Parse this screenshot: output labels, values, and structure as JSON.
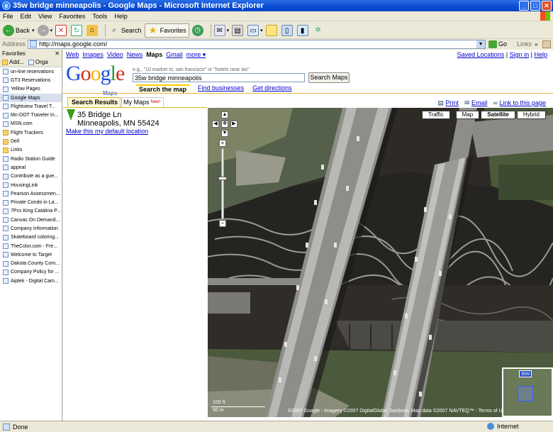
{
  "window": {
    "title": "35w bridge minneapolis - Google Maps - Microsoft Internet Explorer"
  },
  "menu": [
    "File",
    "Edit",
    "View",
    "Favorites",
    "Tools",
    "Help"
  ],
  "toolbar": {
    "back": "Back",
    "search": "Search",
    "favorites": "Favorites"
  },
  "address": {
    "label": "Address",
    "url": "http://maps.google.com/",
    "go": "Go",
    "links": "Links"
  },
  "favorites": {
    "title": "Favorites",
    "add": "Add...",
    "organize": "Orga",
    "items": [
      {
        "label": "on-line reservations",
        "icon": "page-icon"
      },
      {
        "label": "GT3 Reservations",
        "icon": "page-icon"
      },
      {
        "label": "Yellow Pages",
        "icon": "page-icon"
      },
      {
        "label": "Google Maps",
        "icon": "page-icon"
      },
      {
        "label": "Flightview  Travel T...",
        "icon": "page-icon"
      },
      {
        "label": "Mn-DOT Traveler In...",
        "icon": "page-icon"
      },
      {
        "label": "MSN.com",
        "icon": "page-icon"
      },
      {
        "label": "Flight Trackers",
        "icon": "folder-icon"
      },
      {
        "label": "Dell",
        "icon": "folder-icon"
      },
      {
        "label": "Links",
        "icon": "folder-icon"
      },
      {
        "label": "Radio Station Guide",
        "icon": "page-icon"
      },
      {
        "label": "appeal",
        "icon": "page-icon"
      },
      {
        "label": "Contribute as a gue...",
        "icon": "page-icon"
      },
      {
        "label": "HousingLink",
        "icon": "page-icon"
      },
      {
        "label": "Pearson Assessmen...",
        "icon": "page-icon"
      },
      {
        "label": "Private Condo in La...",
        "icon": "page-icon"
      },
      {
        "label": "7Pcs King Catalina P...",
        "icon": "page-icon"
      },
      {
        "label": "Canvas On Demand...",
        "icon": "page-icon"
      },
      {
        "label": "Company Information",
        "icon": "page-icon"
      },
      {
        "label": "Skateboard coloring...",
        "icon": "page-icon"
      },
      {
        "label": "TheColor.com - Fre...",
        "icon": "page-icon"
      },
      {
        "label": "Welcome to Target",
        "icon": "page-icon"
      },
      {
        "label": "Dakota County Com...",
        "icon": "page-icon"
      },
      {
        "label": "Company Policy for ...",
        "icon": "page-icon"
      },
      {
        "label": "Aiptek - Digital Cam...",
        "icon": "page-icon"
      }
    ]
  },
  "gnav": {
    "links": [
      {
        "label": "Web",
        "current": false
      },
      {
        "label": "Images",
        "current": false
      },
      {
        "label": "Video",
        "current": false
      },
      {
        "label": "News",
        "current": false
      },
      {
        "label": "Maps",
        "current": true
      },
      {
        "label": "Gmail",
        "current": false
      },
      {
        "label": "more ▾",
        "current": false
      }
    ],
    "saved_locations": "Saved Locations",
    "sign_in": "Sign in",
    "help": "Help",
    "sep": "|"
  },
  "search": {
    "logo": "Google",
    "logo_sub": "Maps",
    "hint": "e.g., \"10 market st, san francisco\" or \"hotels near lax\"",
    "query": "35w bridge minneapolis",
    "button": "Search Maps",
    "tabs": [
      {
        "label": "Search the map",
        "current": true
      },
      {
        "label": "Find businesses",
        "current": false
      },
      {
        "label": "Get directions",
        "current": false
      }
    ]
  },
  "results": {
    "tab_results": "Search Results",
    "tab_mymaps": "My Maps",
    "tab_new": "New!",
    "address_line1": "35 Bridge Ln",
    "address_line2": "Minneapolis, MN 55424",
    "default_location": "Make this my default location"
  },
  "maplinks": {
    "print": "Print",
    "email": "Email",
    "link": "Link to this page"
  },
  "map": {
    "types": [
      {
        "label": "Traffic",
        "current": false
      },
      {
        "label": "Map",
        "current": false
      },
      {
        "label": "Satellite",
        "current": true
      },
      {
        "label": "Hybrid",
        "current": false
      }
    ],
    "scale_ft": "100 ft",
    "scale_m": "50 m",
    "copyright": "©2007 Google - Imagery ©2007 DigitalGlobe, Sanborn, Map data ©2007 NAVTEQ™ - Terms of Use",
    "overview_shield": "35W"
  },
  "status": {
    "text": "Done",
    "zone": "Internet"
  }
}
